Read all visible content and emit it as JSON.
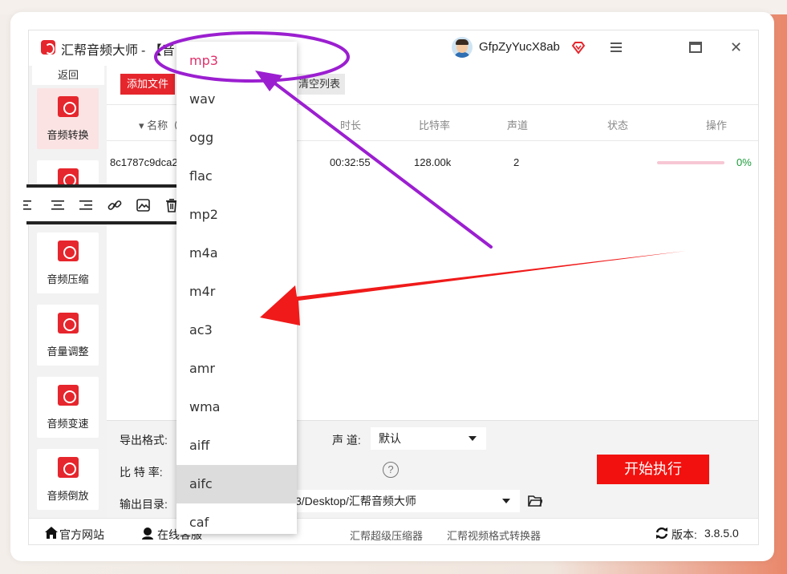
{
  "window": {
    "app_title": "汇帮音频大师",
    "file_title": "- 【音",
    "username": "GfpZyYucX8ab"
  },
  "sidebar": {
    "back_label": "返回",
    "items": [
      {
        "label": "音频转换",
        "icon": "audio-convert-icon"
      },
      {
        "label": "",
        "icon": "audio-merge-icon"
      },
      {
        "label": "音频压缩",
        "icon": "audio-compress-icon"
      },
      {
        "label": "音量调整",
        "icon": "volume-adjust-icon"
      },
      {
        "label": "音频变速",
        "icon": "audio-speed-icon"
      },
      {
        "label": "音频倒放",
        "icon": "audio-reverse-icon"
      }
    ]
  },
  "toolbar": {
    "add_file_label": "添加文件",
    "clear_list_label": "清空列表"
  },
  "table": {
    "headers": {
      "name": "▾ 名称（",
      "duration": "时长",
      "bitrate": "比特率",
      "channels": "声道",
      "status": "状态",
      "actions": "操作"
    },
    "rows": [
      {
        "name": "8c1787c9dca2",
        "duration": "00:32:55",
        "bitrate": "128.00k",
        "channels": "2",
        "progress": 0,
        "percent": "0%"
      }
    ]
  },
  "settings": {
    "export_format_label": "导出格式:",
    "channel_label": "声 道:",
    "channel_value": "默认",
    "bitrate_label": "比 特 率:",
    "output_dir_label": "输出目录:",
    "output_dir_value": "3/Desktop/汇帮音频大师",
    "start_label": "开始执行"
  },
  "footer": {
    "website": "官方网站",
    "online_service": "在线客服",
    "compressor": "汇帮超级压缩器",
    "video_converter": "汇帮视频格式转换器",
    "version_label": "版本:",
    "version": "3.8.5.0"
  },
  "format_dropdown": {
    "selected": "mp3",
    "hovered": "aifc",
    "options": [
      "mp3",
      "wav",
      "ogg",
      "flac",
      "mp2",
      "m4a",
      "m4r",
      "ac3",
      "amr",
      "wma",
      "aiff",
      "aifc",
      "caf"
    ]
  },
  "colors": {
    "brand_red": "#e6262d",
    "annotation_purple": "#9b1fd0",
    "annotation_red": "#f01a1a",
    "selected_option": "#e0306a",
    "success_green": "#1a9a38"
  }
}
